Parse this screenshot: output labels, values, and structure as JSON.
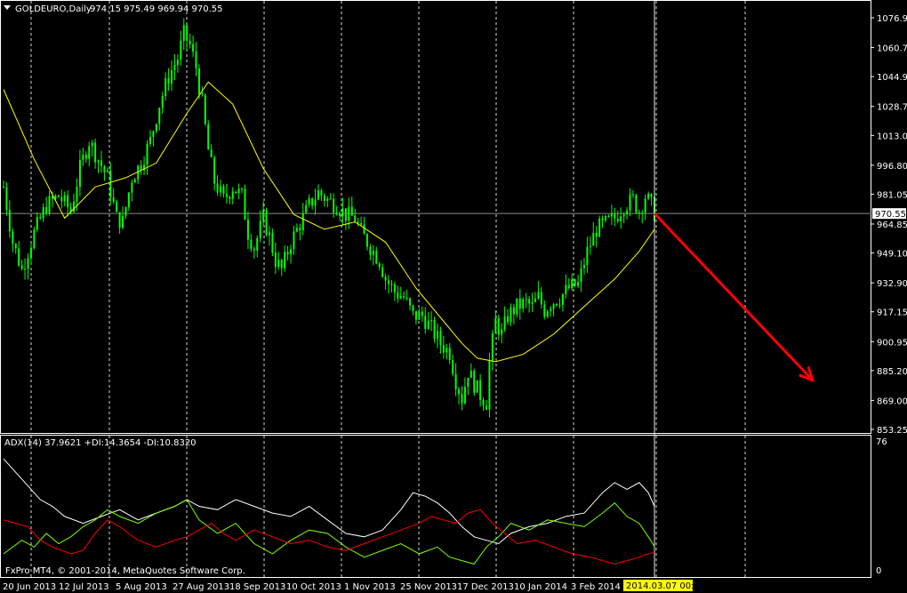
{
  "header": {
    "symbol": "GOLDEURO,Daily",
    "ohlc": "974.15 975.49 969.94 970.55"
  },
  "indicator": {
    "label": "ADX(14) 37.9621 +DI:14.3654 -DI:10.8320"
  },
  "footer": {
    "copyright": "FxPro MT4, © 2001-2014, MetaQuotes Software Corp."
  },
  "colors": {
    "background": "#000000",
    "candles": "#00ff00",
    "moving_average": "#ffff00",
    "adx": "#ffffff",
    "plus_di": "#7fff00",
    "minus_di": "#ff0000",
    "arrow": "#ff0000",
    "grid": "#ffffff",
    "frame": "#ffffff"
  },
  "chart_data": [
    {
      "type": "candlestick",
      "title": "GOLDEURO,Daily",
      "ylim": [
        853.25,
        1088
      ],
      "price_ticks": [
        "1076.90",
        "1060.70",
        "1044.95",
        "1028.75",
        "1013.00",
        "996.80",
        "981.05",
        "964.85",
        "949.10",
        "932.90",
        "917.15",
        "900.95",
        "885.20",
        "869.00",
        "853.25"
      ],
      "current_price": "970.55",
      "x_labels": [
        "20 Jun 2013",
        "12 Jul 2013",
        "5 Aug 2013",
        "27 Aug 2013",
        "18 Sep 2013",
        "10 Oct 2013",
        "1 Nov 2013",
        "25 Nov 2013",
        "17 Dec 2013",
        "10 Jan 2014",
        "3 Feb 2014"
      ],
      "cursor_label": "2014.03.07 00:00",
      "close_path": [
        {
          "x": 0,
          "y": 985
        },
        {
          "x": 3,
          "y": 955
        },
        {
          "x": 6,
          "y": 940
        },
        {
          "x": 10,
          "y": 960
        },
        {
          "x": 14,
          "y": 975
        },
        {
          "x": 18,
          "y": 980
        },
        {
          "x": 22,
          "y": 972
        },
        {
          "x": 25,
          "y": 995
        },
        {
          "x": 28,
          "y": 1010
        },
        {
          "x": 31,
          "y": 1000
        },
        {
          "x": 34,
          "y": 990
        },
        {
          "x": 37,
          "y": 968
        },
        {
          "x": 39,
          "y": 966
        },
        {
          "x": 42,
          "y": 990
        },
        {
          "x": 45,
          "y": 998
        },
        {
          "x": 48,
          "y": 1010
        },
        {
          "x": 51,
          "y": 1030
        },
        {
          "x": 54,
          "y": 1045
        },
        {
          "x": 57,
          "y": 1055
        },
        {
          "x": 59,
          "y": 1068
        },
        {
          "x": 61,
          "y": 1062
        },
        {
          "x": 63,
          "y": 1050
        },
        {
          "x": 65,
          "y": 1030
        },
        {
          "x": 67,
          "y": 1005
        },
        {
          "x": 69,
          "y": 988
        },
        {
          "x": 72,
          "y": 978
        },
        {
          "x": 75,
          "y": 985
        },
        {
          "x": 78,
          "y": 980
        },
        {
          "x": 80,
          "y": 960
        },
        {
          "x": 82,
          "y": 952
        },
        {
          "x": 85,
          "y": 968
        },
        {
          "x": 87,
          "y": 958
        },
        {
          "x": 89,
          "y": 945
        },
        {
          "x": 91,
          "y": 940
        },
        {
          "x": 94,
          "y": 955
        },
        {
          "x": 97,
          "y": 965
        },
        {
          "x": 100,
          "y": 975
        },
        {
          "x": 103,
          "y": 982
        },
        {
          "x": 106,
          "y": 978
        },
        {
          "x": 109,
          "y": 975
        },
        {
          "x": 112,
          "y": 970
        },
        {
          "x": 115,
          "y": 968
        },
        {
          "x": 117,
          "y": 960
        },
        {
          "x": 119,
          "y": 955
        },
        {
          "x": 121,
          "y": 950
        },
        {
          "x": 123,
          "y": 945
        },
        {
          "x": 125,
          "y": 935
        },
        {
          "x": 128,
          "y": 928
        },
        {
          "x": 131,
          "y": 925
        },
        {
          "x": 134,
          "y": 915
        },
        {
          "x": 137,
          "y": 915
        },
        {
          "x": 140,
          "y": 908
        },
        {
          "x": 143,
          "y": 900
        },
        {
          "x": 146,
          "y": 895
        },
        {
          "x": 148,
          "y": 880
        },
        {
          "x": 150,
          "y": 870
        },
        {
          "x": 152,
          "y": 885
        },
        {
          "x": 154,
          "y": 878
        },
        {
          "x": 156,
          "y": 872
        },
        {
          "x": 158,
          "y": 868
        },
        {
          "x": 159,
          "y": 890
        },
        {
          "x": 161,
          "y": 912
        },
        {
          "x": 163,
          "y": 905
        },
        {
          "x": 165,
          "y": 915
        },
        {
          "x": 168,
          "y": 920
        },
        {
          "x": 171,
          "y": 922
        },
        {
          "x": 173,
          "y": 920
        },
        {
          "x": 175,
          "y": 925
        },
        {
          "x": 177,
          "y": 918
        },
        {
          "x": 179,
          "y": 922
        },
        {
          "x": 182,
          "y": 925
        },
        {
          "x": 185,
          "y": 930
        },
        {
          "x": 188,
          "y": 932
        },
        {
          "x": 191,
          "y": 950
        },
        {
          "x": 194,
          "y": 962
        },
        {
          "x": 197,
          "y": 965
        },
        {
          "x": 200,
          "y": 968
        },
        {
          "x": 203,
          "y": 975
        },
        {
          "x": 206,
          "y": 978
        },
        {
          "x": 208,
          "y": 972
        },
        {
          "x": 210,
          "y": 980
        },
        {
          "x": 212,
          "y": 975
        },
        {
          "x": 213,
          "y": 970.55
        }
      ],
      "moving_average": [
        {
          "x": 0,
          "y": 1038
        },
        {
          "x": 10,
          "y": 1000
        },
        {
          "x": 20,
          "y": 968
        },
        {
          "x": 30,
          "y": 985
        },
        {
          "x": 40,
          "y": 990
        },
        {
          "x": 50,
          "y": 998
        },
        {
          "x": 60,
          "y": 1025
        },
        {
          "x": 67,
          "y": 1042
        },
        {
          "x": 75,
          "y": 1030
        },
        {
          "x": 85,
          "y": 995
        },
        {
          "x": 95,
          "y": 970
        },
        {
          "x": 105,
          "y": 962
        },
        {
          "x": 115,
          "y": 966
        },
        {
          "x": 125,
          "y": 955
        },
        {
          "x": 135,
          "y": 930
        },
        {
          "x": 145,
          "y": 910
        },
        {
          "x": 150,
          "y": 900
        },
        {
          "x": 155,
          "y": 892
        },
        {
          "x": 161,
          "y": 890
        },
        {
          "x": 170,
          "y": 894
        },
        {
          "x": 180,
          "y": 905
        },
        {
          "x": 190,
          "y": 920
        },
        {
          "x": 200,
          "y": 935
        },
        {
          "x": 208,
          "y": 950
        },
        {
          "x": 213,
          "y": 962
        }
      ],
      "forecast_arrow": {
        "from": {
          "x": 213,
          "y": 970.55
        },
        "to": {
          "x": 240,
          "y": 880
        }
      }
    },
    {
      "type": "line",
      "title": "ADX(14) 37.9621 +DI:14.3654 -DI:10.8320",
      "ylim": [
        0,
        76
      ],
      "y_ticks": [
        "76",
        "0"
      ],
      "series": [
        {
          "name": "ADX(14)",
          "color": "#ffffff",
          "values": [
            {
              "x": 0,
              "y": 66
            },
            {
              "x": 4,
              "y": 58
            },
            {
              "x": 8,
              "y": 50
            },
            {
              "x": 12,
              "y": 42
            },
            {
              "x": 16,
              "y": 38
            },
            {
              "x": 20,
              "y": 32
            },
            {
              "x": 26,
              "y": 28
            },
            {
              "x": 32,
              "y": 32
            },
            {
              "x": 38,
              "y": 36
            },
            {
              "x": 44,
              "y": 30
            },
            {
              "x": 50,
              "y": 34
            },
            {
              "x": 56,
              "y": 38
            },
            {
              "x": 60,
              "y": 42
            },
            {
              "x": 64,
              "y": 38
            },
            {
              "x": 70,
              "y": 36
            },
            {
              "x": 76,
              "y": 42
            },
            {
              "x": 82,
              "y": 38
            },
            {
              "x": 88,
              "y": 34
            },
            {
              "x": 94,
              "y": 32
            },
            {
              "x": 100,
              "y": 38
            },
            {
              "x": 106,
              "y": 30
            },
            {
              "x": 112,
              "y": 22
            },
            {
              "x": 118,
              "y": 20
            },
            {
              "x": 124,
              "y": 24
            },
            {
              "x": 130,
              "y": 36
            },
            {
              "x": 134,
              "y": 46
            },
            {
              "x": 138,
              "y": 44
            },
            {
              "x": 142,
              "y": 40
            },
            {
              "x": 146,
              "y": 34
            },
            {
              "x": 150,
              "y": 26
            },
            {
              "x": 154,
              "y": 20
            },
            {
              "x": 158,
              "y": 18
            },
            {
              "x": 162,
              "y": 16
            },
            {
              "x": 166,
              "y": 22
            },
            {
              "x": 172,
              "y": 26
            },
            {
              "x": 178,
              "y": 28
            },
            {
              "x": 184,
              "y": 32
            },
            {
              "x": 190,
              "y": 34
            },
            {
              "x": 196,
              "y": 46
            },
            {
              "x": 200,
              "y": 52
            },
            {
              "x": 204,
              "y": 48
            },
            {
              "x": 208,
              "y": 52
            },
            {
              "x": 211,
              "y": 46
            },
            {
              "x": 213,
              "y": 37.96
            }
          ]
        },
        {
          "name": "+DI",
          "color": "#7fff00",
          "values": [
            {
              "x": 0,
              "y": 10
            },
            {
              "x": 6,
              "y": 18
            },
            {
              "x": 10,
              "y": 14
            },
            {
              "x": 14,
              "y": 22
            },
            {
              "x": 18,
              "y": 16
            },
            {
              "x": 22,
              "y": 20
            },
            {
              "x": 26,
              "y": 26
            },
            {
              "x": 30,
              "y": 30
            },
            {
              "x": 34,
              "y": 36
            },
            {
              "x": 38,
              "y": 32
            },
            {
              "x": 44,
              "y": 28
            },
            {
              "x": 50,
              "y": 34
            },
            {
              "x": 56,
              "y": 38
            },
            {
              "x": 60,
              "y": 42
            },
            {
              "x": 64,
              "y": 30
            },
            {
              "x": 70,
              "y": 22
            },
            {
              "x": 76,
              "y": 28
            },
            {
              "x": 82,
              "y": 16
            },
            {
              "x": 88,
              "y": 10
            },
            {
              "x": 94,
              "y": 18
            },
            {
              "x": 100,
              "y": 24
            },
            {
              "x": 106,
              "y": 22
            },
            {
              "x": 112,
              "y": 14
            },
            {
              "x": 118,
              "y": 8
            },
            {
              "x": 124,
              "y": 12
            },
            {
              "x": 130,
              "y": 16
            },
            {
              "x": 136,
              "y": 10
            },
            {
              "x": 142,
              "y": 14
            },
            {
              "x": 146,
              "y": 8
            },
            {
              "x": 150,
              "y": 6
            },
            {
              "x": 154,
              "y": 4
            },
            {
              "x": 158,
              "y": 14
            },
            {
              "x": 162,
              "y": 20
            },
            {
              "x": 166,
              "y": 28
            },
            {
              "x": 172,
              "y": 24
            },
            {
              "x": 178,
              "y": 30
            },
            {
              "x": 184,
              "y": 28
            },
            {
              "x": 190,
              "y": 26
            },
            {
              "x": 196,
              "y": 34
            },
            {
              "x": 200,
              "y": 40
            },
            {
              "x": 204,
              "y": 32
            },
            {
              "x": 208,
              "y": 28
            },
            {
              "x": 211,
              "y": 20
            },
            {
              "x": 213,
              "y": 14.37
            }
          ]
        },
        {
          "name": "-DI",
          "color": "#ff0000",
          "values": [
            {
              "x": 0,
              "y": 30
            },
            {
              "x": 4,
              "y": 28
            },
            {
              "x": 8,
              "y": 26
            },
            {
              "x": 12,
              "y": 18
            },
            {
              "x": 16,
              "y": 14
            },
            {
              "x": 22,
              "y": 10
            },
            {
              "x": 26,
              "y": 12
            },
            {
              "x": 30,
              "y": 22
            },
            {
              "x": 34,
              "y": 30
            },
            {
              "x": 38,
              "y": 26
            },
            {
              "x": 44,
              "y": 18
            },
            {
              "x": 50,
              "y": 14
            },
            {
              "x": 56,
              "y": 18
            },
            {
              "x": 60,
              "y": 20
            },
            {
              "x": 64,
              "y": 24
            },
            {
              "x": 68,
              "y": 28
            },
            {
              "x": 72,
              "y": 22
            },
            {
              "x": 76,
              "y": 18
            },
            {
              "x": 82,
              "y": 24
            },
            {
              "x": 88,
              "y": 20
            },
            {
              "x": 94,
              "y": 16
            },
            {
              "x": 100,
              "y": 18
            },
            {
              "x": 106,
              "y": 14
            },
            {
              "x": 112,
              "y": 12
            },
            {
              "x": 118,
              "y": 16
            },
            {
              "x": 124,
              "y": 20
            },
            {
              "x": 130,
              "y": 24
            },
            {
              "x": 136,
              "y": 28
            },
            {
              "x": 140,
              "y": 32
            },
            {
              "x": 144,
              "y": 30
            },
            {
              "x": 148,
              "y": 28
            },
            {
              "x": 152,
              "y": 34
            },
            {
              "x": 156,
              "y": 36
            },
            {
              "x": 160,
              "y": 28
            },
            {
              "x": 164,
              "y": 22
            },
            {
              "x": 168,
              "y": 16
            },
            {
              "x": 174,
              "y": 18
            },
            {
              "x": 180,
              "y": 14
            },
            {
              "x": 186,
              "y": 10
            },
            {
              "x": 192,
              "y": 8
            },
            {
              "x": 196,
              "y": 6
            },
            {
              "x": 200,
              "y": 4
            },
            {
              "x": 204,
              "y": 6
            },
            {
              "x": 208,
              "y": 8
            },
            {
              "x": 211,
              "y": 10
            },
            {
              "x": 213,
              "y": 10.83
            }
          ]
        }
      ]
    }
  ]
}
